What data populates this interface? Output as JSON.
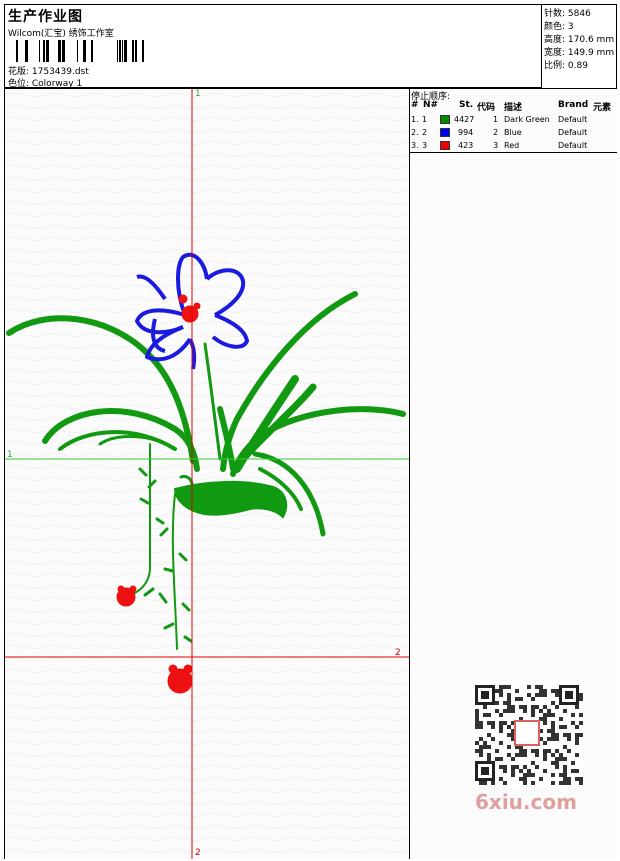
{
  "header": {
    "title": "生产作业图",
    "company": "Wilcom(汇宝) 绣饰工作室",
    "design_label": "花版: 1753439.dst",
    "colorway_label": "色位: Colorway 1"
  },
  "stats": [
    {
      "label": "针数:",
      "value": "5846"
    },
    {
      "label": "颜色:",
      "value": "3"
    },
    {
      "label": "高度:",
      "value": "170.6 mm"
    },
    {
      "label": "宽度:",
      "value": "149.9 mm"
    },
    {
      "label": "比例:",
      "value": "0.89"
    }
  ],
  "sequence": {
    "title": "停止顺序:",
    "headers": {
      "num": "#",
      "n": "N#",
      "stitches": "St.",
      "code": "代码",
      "desc": "描述",
      "brand": "Brand",
      "element": "元素"
    },
    "rows": [
      {
        "num": "1.",
        "n": "1",
        "color": "#008800",
        "stitches": "4427",
        "code": "1",
        "desc": "Dark Green",
        "brand": "Default"
      },
      {
        "num": "2.",
        "n": "2",
        "color": "#0000ee",
        "stitches": "994",
        "code": "2",
        "desc": "Blue",
        "brand": "Default"
      },
      {
        "num": "3.",
        "n": "3",
        "color": "#ee0000",
        "stitches": "423",
        "code": "3",
        "desc": "Red",
        "brand": "Default"
      }
    ]
  },
  "guides": {
    "v1_label": "1",
    "v2_label": "2",
    "h1_label": "1",
    "h2_label": "2"
  },
  "colors": {
    "green": "#119911",
    "blue": "#1a1ae0",
    "red": "#ee1111",
    "guide_red": "#dd0000",
    "guide_green": "#33cc33"
  },
  "watermark": "6xiu.com"
}
